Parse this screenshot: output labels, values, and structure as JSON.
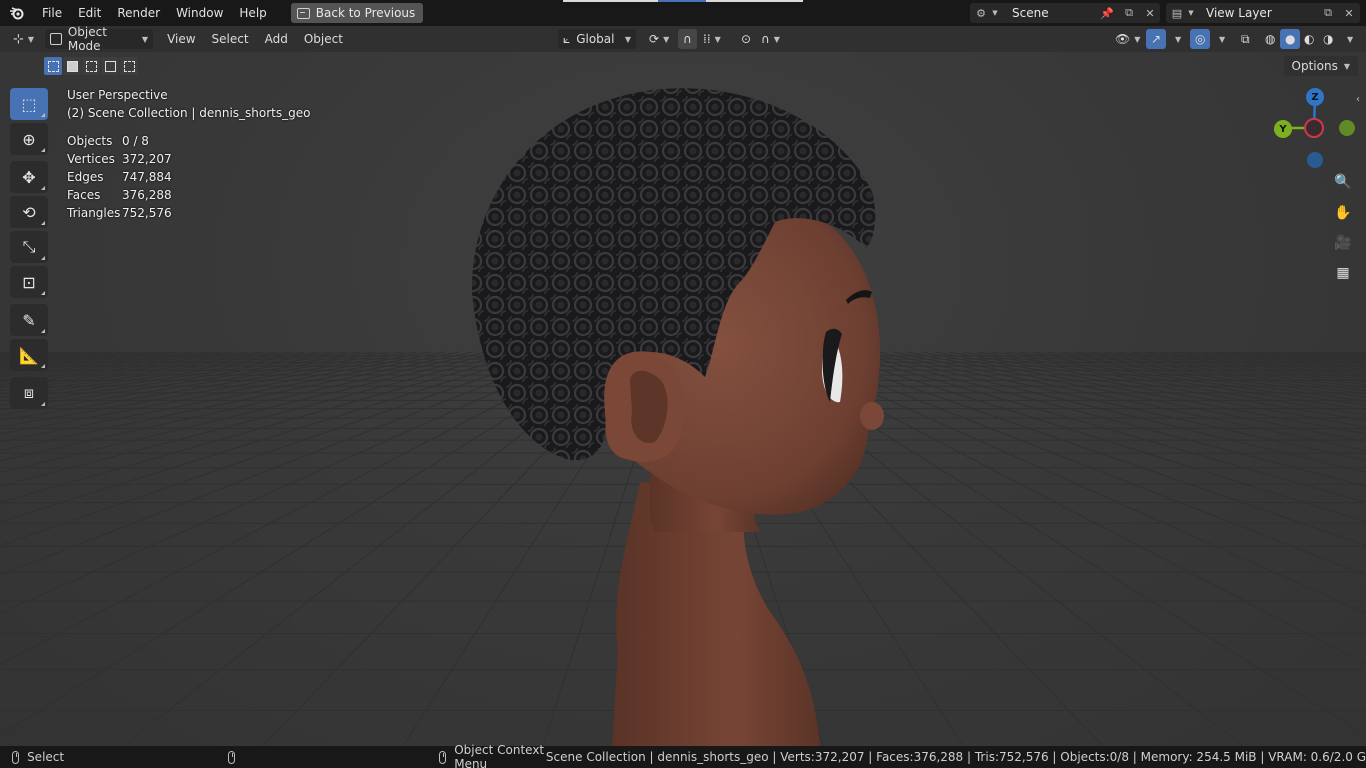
{
  "topbar": {
    "menus": [
      "File",
      "Edit",
      "Render",
      "Window",
      "Help"
    ],
    "back_button": "Back to Previous",
    "scene_label": "Scene",
    "view_layer_label": "View Layer"
  },
  "header": {
    "mode": "Object Mode",
    "menus": [
      "View",
      "Select",
      "Add",
      "Object"
    ],
    "transform_orientation": "Global",
    "options_label": "Options"
  },
  "viewport": {
    "view_name": "User Perspective",
    "collection": "(2) Scene Collection | dennis_shorts_geo",
    "stats": [
      {
        "label": "Objects",
        "value": "0 / 8"
      },
      {
        "label": "Vertices",
        "value": "372,207"
      },
      {
        "label": "Edges",
        "value": "747,884"
      },
      {
        "label": "Faces",
        "value": "376,288"
      },
      {
        "label": "Triangles",
        "value": "752,576"
      }
    ],
    "gizmo": {
      "x": "",
      "y": "Y",
      "z": "Z"
    }
  },
  "statusbar": {
    "left_action": "Select",
    "right_action": "Object Context Menu",
    "info": "Scene Collection | dennis_shorts_geo | Verts:372,207 | Faces:376,288 | Tris:752,576 | Objects:0/8 | Memory: 254.5 MiB | VRAM: 0.6/2.0 G"
  },
  "colors": {
    "accent": "#4772b3",
    "axis_x": "#d0384a",
    "axis_y": "#7db020",
    "axis_z": "#2f75c9",
    "skin": "#6e4032",
    "hair": "#1a1a1c"
  }
}
